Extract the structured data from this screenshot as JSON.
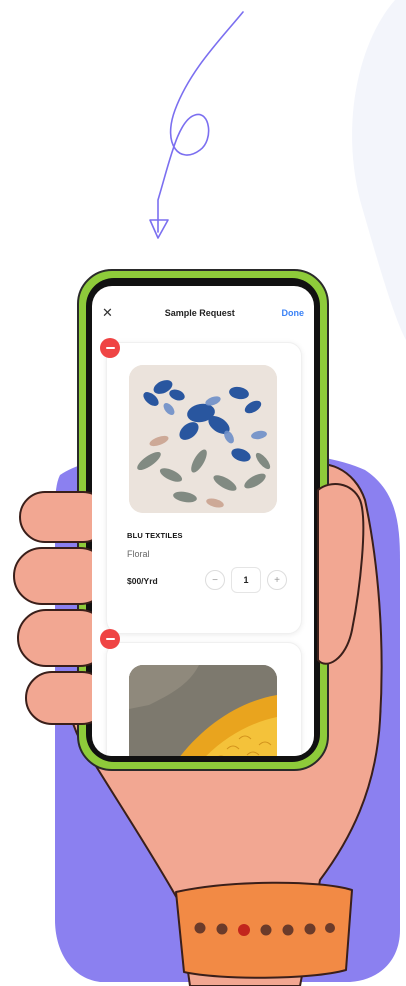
{
  "header": {
    "title": "Sample Request",
    "close_icon": "close-icon",
    "done_label": "Done"
  },
  "items": [
    {
      "brand": "BLU TEXTILES",
      "pattern": "Floral",
      "price": "$00/Yrd",
      "quantity": "1",
      "decrement": "−",
      "increment": "+"
    },
    {
      "brand": "",
      "pattern": "",
      "price": "",
      "quantity": ""
    }
  ],
  "colors": {
    "background_blob": "#8b80f0",
    "skin": "#f2a792",
    "phone_frame": "#8ecb3a",
    "watch_band": "#f28a45",
    "accent_blue": "#3b82f6",
    "remove_red": "#ef4444"
  },
  "watch_dot_count": 7
}
